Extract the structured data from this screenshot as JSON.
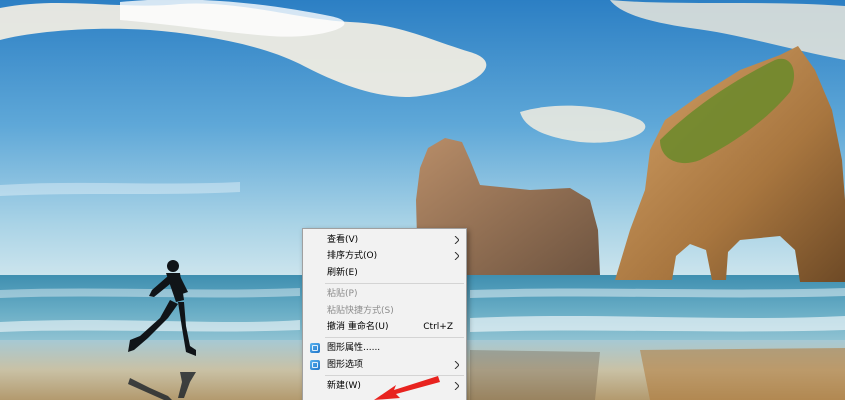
{
  "context_menu": {
    "items": [
      {
        "label": "查看(V)",
        "submenu": true,
        "enabled": true
      },
      {
        "label": "排序方式(O)",
        "submenu": true,
        "enabled": true
      },
      {
        "label": "刷新(E)",
        "enabled": true
      },
      {
        "label": "粘贴(P)",
        "enabled": false
      },
      {
        "label": "粘贴快捷方式(S)",
        "enabled": false
      },
      {
        "label": "撤消 重命名(U)",
        "shortcut": "Ctrl+Z",
        "enabled": true
      },
      {
        "label": "图形属性......",
        "icon": "graphics-icon",
        "enabled": true
      },
      {
        "label": "图形选项",
        "icon": "graphics-icon",
        "submenu": true,
        "enabled": true
      },
      {
        "label": "新建(W)",
        "submenu": true,
        "enabled": true
      }
    ]
  },
  "annotation": {
    "color": "#e8231f",
    "icon": "red-arrow-icon"
  }
}
